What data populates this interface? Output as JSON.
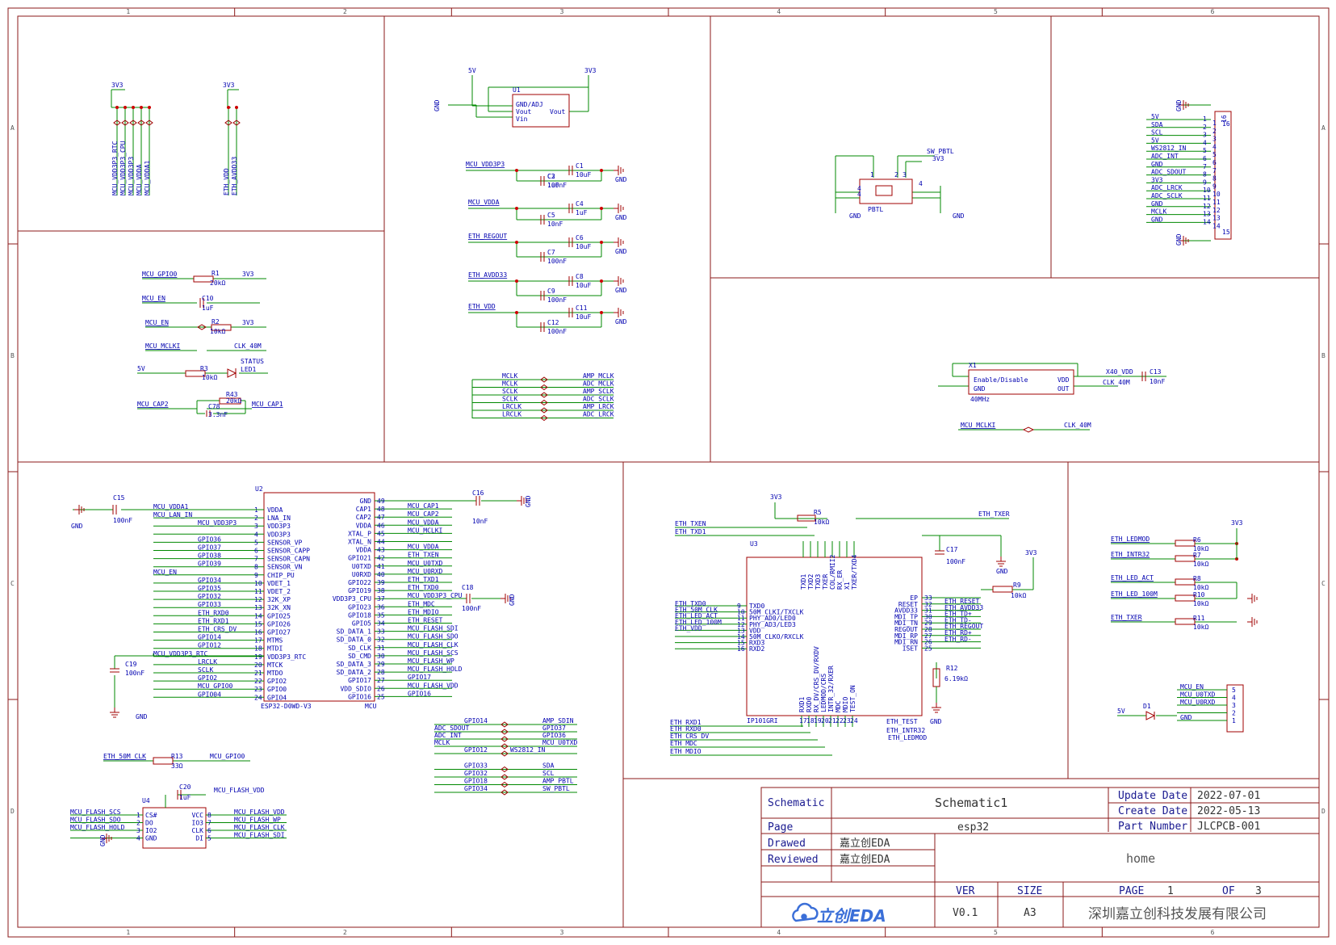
{
  "colors": {
    "frame": "#8b1a1a",
    "wire": "#008800",
    "net": "#0000b0",
    "part": "#a00000",
    "junction": "#cc0000",
    "grid": "#606060"
  },
  "grid": {
    "cols": [
      "1",
      "2",
      "3",
      "4",
      "5",
      "6"
    ],
    "rows": [
      "A",
      "B",
      "C",
      "D"
    ]
  },
  "power_caps": {
    "rail": "3V3",
    "nets_left": [
      "MCU_VDD3P3_RTC",
      "MCU_VDD3P3_CPU",
      "MCU_VDD3P3",
      "MCU_VDDA",
      "MCU_VDDA1"
    ],
    "nets_right": [
      "ETH_VDD",
      "ETH_AVDD33"
    ]
  },
  "ldo": {
    "ref": "U1",
    "in_rail": "5V",
    "out_rail": "3V3",
    "pins": [
      "GND/ADJ",
      "Vout",
      "Vin",
      "Vout"
    ],
    "gnd": "GND"
  },
  "decoupling": [
    {
      "net": "MCU_VDD3P3",
      "caps": [
        {
          "ref": "C1",
          "val": "10uF"
        },
        {
          "ref": "C2",
          "val": "100nF"
        },
        {
          "ref": "C3",
          "val": "1uF"
        }
      ],
      "gnd": "GND"
    },
    {
      "net": "MCU_VDDA",
      "caps": [
        {
          "ref": "C4",
          "val": "1uF"
        },
        {
          "ref": "C5",
          "val": "10nF"
        }
      ],
      "gnd": "GND"
    },
    {
      "net": "ETH_REGOUT",
      "caps": [
        {
          "ref": "C6",
          "val": "10uF"
        },
        {
          "ref": "C7",
          "val": "100nF"
        }
      ],
      "gnd": "GND"
    },
    {
      "net": "ETH_AVDD33",
      "caps": [
        {
          "ref": "C8",
          "val": "10uF"
        },
        {
          "ref": "C9",
          "val": "100nF"
        }
      ],
      "gnd": "GND"
    },
    {
      "net": "ETH_VDD",
      "caps": [
        {
          "ref": "C11",
          "val": "10uF"
        },
        {
          "ref": "C12",
          "val": "100nF"
        }
      ],
      "gnd": "GND"
    }
  ],
  "net_ties": [
    [
      "MCLK",
      "AMP_MCLK"
    ],
    [
      "MCLK",
      "ADC_MCLK"
    ],
    [
      "SCLK",
      "AMP_SCLK"
    ],
    [
      "SCLK",
      "ADC_SCLK"
    ],
    [
      "LRCLK",
      "AMP_LRCK"
    ],
    [
      "LRCLK",
      "ADC_LRCK"
    ]
  ],
  "pbtl": {
    "ref": "PBTL",
    "net": "SW_PBTL",
    "rail": "3V3",
    "gnd": "GND",
    "pins": [
      "1",
      "2",
      "3",
      "4",
      "4",
      "4"
    ]
  },
  "header16": {
    "ref": "16",
    "gnd": "GND",
    "nets": [
      "5V",
      "SDA",
      "SCL",
      "5V",
      "WS2812_IN",
      "ADC_INT",
      "GND",
      "ADC_SDOUT",
      "3V3",
      "ADC_LRCK",
      "ADC_SCLK",
      "GND",
      "MCLK",
      "GND"
    ],
    "pins": [
      "1",
      "2",
      "3",
      "4",
      "5",
      "6",
      "7",
      "8",
      "9",
      "10",
      "11",
      "12",
      "13",
      "14",
      "15",
      "16"
    ]
  },
  "oscillator": {
    "ref": "X1",
    "pins": [
      "Enable/Disable",
      "GND",
      "VDD",
      "OUT"
    ],
    "freq": "40MHz",
    "vdd_net": "X40_VDD",
    "out_net": "CLK_40M",
    "cap": {
      "ref": "C13",
      "val": "10nF"
    },
    "tie": [
      "MCU_MCLKI",
      "CLK_40M"
    ]
  },
  "misc_left": [
    {
      "net": "MCU_GPIO0",
      "ref": "R1",
      "val": "20kΩ",
      "to": "3V3"
    },
    {
      "net": "MCU_EN",
      "ref": "C10",
      "val": "1uF",
      "to": "GND"
    },
    {
      "net": "MCU_EN",
      "ref": "R2",
      "val": "10kΩ",
      "to": "3V3"
    },
    {
      "net": "MCU_MCLKI",
      "to": "CLK_40M"
    },
    {
      "net": "5V",
      "ref": "R3",
      "val": "10kΩ",
      "led": "LED1",
      "led_label": "STATUS",
      "to": "GND"
    },
    {
      "net": "MCU_CAP2",
      "ref": "R43",
      "val": "20kΩ",
      "cap_ref": "C78",
      "cap_val": "3.3nF",
      "to": "MCU_CAP1"
    }
  ],
  "mcu": {
    "ref": "U2",
    "name": "ESP32-D0WD-V3",
    "label": "MCU",
    "left_pins": [
      "VDDA",
      "LNA_IN",
      "VDD3P3",
      "VDD3P3",
      "SENSOR_VP",
      "SENSOR_CAPP",
      "SENSOR_CAPN",
      "SENSOR_VN",
      "CHIP_PU",
      "VDET_1",
      "VDET_2",
      "32K_XP",
      "32K_XN",
      "GPIO25",
      "GPIO26",
      "GPIO27",
      "MTMS",
      "MTDI",
      "VDD3P3_RTC",
      "MTCK",
      "MTDO",
      "GPIO2",
      "GPIO0",
      "GPIO4"
    ],
    "right_pins": [
      "GND",
      "CAP1",
      "CAP2",
      "VDDA",
      "XTAL_P",
      "XTAL_N",
      "VDDA",
      "GPIO21",
      "U0TXD",
      "U0RXD",
      "GPIO22",
      "GPIO19",
      "VDD3P3_CPU",
      "GPIO23",
      "GPIO18",
      "GPIO5",
      "SD_DATA_1",
      "SD_DATA_0",
      "SD_CLK",
      "SD_CMD",
      "SD_DATA_3",
      "SD_DATA_2",
      "GPIO17",
      "VDD_SDIO",
      "GPIO16"
    ],
    "left_nets": [
      "MCU_VDDA1",
      "MCU_LAN_IN",
      "MCU_VDD3P3",
      "",
      "GPIO36",
      "GPIO37",
      "GPIO38",
      "GPIO39",
      "MCU_EN",
      "GPIO34",
      "GPIO35",
      "GPIO32",
      "GPIO33",
      "ETH_RXD0",
      "ETH_RXD1",
      "ETH_CRS_DV",
      "GPIO14",
      "GPIO12",
      "MCU_VDD3P3_RTC",
      "LRCLK",
      "SCLK",
      "GPIO2",
      "MCU_GPIO0",
      "GPIO04"
    ],
    "right_nets": [
      "",
      "MCU_CAP1",
      "MCU_CAP2",
      "MCU_VDDA",
      "MCU_MCLKI",
      "",
      "MCU_VDDA",
      "ETH_TXEN",
      "MCU_U0TXD",
      "MCU_U0RXD",
      "ETH_TXD1",
      "ETH_TXD0",
      "MCU_VDD3P3_CPU",
      "ETH_MDC",
      "ETH_MDIO",
      "ETH_RESET",
      "MCU_FLASH_SDI",
      "MCU_FLASH_SDO",
      "MCU_FLASH_CLK",
      "MCU_FLASH_SCS",
      "MCU_FLASH_WP",
      "MCU_FLASH_HOLD",
      "GPIO17",
      "MCU_FLASH_VDD",
      "GPIO16"
    ],
    "caps": [
      {
        "ref": "C15",
        "val": "100nF"
      },
      {
        "ref": "C16",
        "val": "10nF"
      },
      {
        "ref": "C18",
        "val": "100nF"
      },
      {
        "ref": "C19",
        "val": "100nF"
      }
    ],
    "gnd": "GND"
  },
  "gpio_ties": [
    [
      "GPIO14",
      "AMP_SDIN"
    ],
    [
      "ADC_SDOUT",
      "GPIO37"
    ],
    [
      "ADC_INT",
      "GPIO36"
    ],
    [
      "MCLK",
      "MCU_U0TXD"
    ],
    [
      "GPIO12",
      "WS2812_IN"
    ],
    [
      "GPIO33",
      "SDA"
    ],
    [
      "GPIO32",
      "SCL"
    ],
    [
      "GPIO18",
      "AMP_PBTL"
    ],
    [
      "GPIO34",
      "SW_PBTL"
    ]
  ],
  "r13": {
    "net": "ETH_50M_CLK",
    "ref": "R13",
    "val": "33Ω",
    "to": "MCU_GPIO0"
  },
  "flash": {
    "ref": "U4",
    "cap": {
      "ref": "C20",
      "val": "1uF",
      "net": "MCU_FLASH_VDD"
    },
    "left_pins": [
      "CS#",
      "DO",
      "IO2",
      "GND"
    ],
    "left_nums": [
      "1",
      "2",
      "3",
      "4"
    ],
    "right_pins": [
      "VCC",
      "IO3",
      "CLK",
      "DI"
    ],
    "right_nums": [
      "8",
      "7",
      "6",
      "5"
    ],
    "left_nets": [
      "MCU_FLASH_SCS",
      "MCU_FLASH_SDO",
      "MCU_FLASH_HOLD"
    ],
    "right_nets": [
      "MCU_FLASH_VDD",
      "MCU_FLASH_WP",
      "MCU_FLASH_CLK",
      "MCU_FLASH_SDI"
    ],
    "gnd": "GND"
  },
  "phy": {
    "ref": "U3",
    "name": "IP101GRI",
    "rail": "3V3",
    "top_pins": [
      "TXD1",
      "TXD2",
      "TXD3",
      "TXER",
      "COL/RMII2",
      "RX_ER",
      "X1",
      "TXER/TXD4"
    ],
    "left_pins": [
      "TXD0",
      "50M_CLKI/TXCLK",
      "PHY_AD0/LED0",
      "PHY_AD3/LED3",
      "VDD",
      "50M_CLKO/RXCLK",
      "RXD3",
      "RXD2"
    ],
    "left_nums": [
      "9",
      "10",
      "11",
      "12",
      "13",
      "14",
      "15",
      "16"
    ],
    "right_pins": [
      "EP",
      "RESET",
      "AVDD33",
      "MDI_TP",
      "MDI_TN",
      "REGOUT",
      "MDI_RP",
      "MDI_RN",
      "ISET"
    ],
    "right_nums": [
      "33",
      "32",
      "31",
      "30",
      "29",
      "28",
      "27",
      "26",
      "25"
    ],
    "bottom_pins": [
      "RXD1",
      "RXD0",
      "RX_DV/CRS_DV/RXDV",
      "LEDMOD/CRS",
      "INTR_32/RXER",
      "MDC",
      "MDIO",
      "TEST_ON"
    ],
    "bottom_nums": [
      "17",
      "18",
      "19",
      "20",
      "21",
      "22",
      "23",
      "24"
    ],
    "left_nets": [
      "ETH_TXD0",
      "ETH_50M_CLK",
      "ETH_LED_ACT",
      "ETH_LED_100M",
      "ETH_VDD"
    ],
    "right_nets": [
      "ETH_RESET",
      "ETH_AVDD33",
      "ETH_TD+",
      "ETH_TD-",
      "ETH_REGOUT",
      "ETH_RD+",
      "ETH_RD-"
    ],
    "top_nets": [
      "ETH_TXEN",
      "ETH_TXD1",
      "ETH_TXER"
    ],
    "bottom_nets": [
      "ETH_RXD1",
      "ETH_RXD0",
      "ETH_CRS_DV",
      "ETH_MDC",
      "ETH_MDIO",
      "ETH_TEST",
      "ETH_INTR32",
      "ETH_LEDMOD"
    ],
    "parts": [
      {
        "ref": "R5",
        "val": "10kΩ"
      },
      {
        "ref": "R9",
        "val": "10kΩ"
      },
      {
        "ref": "R12",
        "val": "6.19kΩ"
      },
      {
        "ref": "C17",
        "val": "100nF"
      }
    ],
    "gnd": "GND"
  },
  "eth_straps": [
    {
      "net": "ETH_LEDMOD",
      "ref": "R6",
      "val": "10kΩ"
    },
    {
      "net": "ETH_INTR32",
      "ref": "R7",
      "val": "10kΩ"
    },
    {
      "net": "ETH_LED_ACT",
      "ref": "R8",
      "val": "10kΩ"
    },
    {
      "net": "ETH_LED_100M",
      "ref": "R10",
      "val": "10kΩ"
    },
    {
      "net": "ETH_TXER",
      "ref": "R11",
      "val": "10kΩ"
    }
  ],
  "eth_straps_rail": "3V3",
  "uart_header": {
    "nets": [
      "MCU_EN",
      "MCU_U0TXD",
      "MCU_U0RXD",
      "5V",
      "GND"
    ],
    "pins": [
      "5",
      "4",
      "3",
      "2",
      "1"
    ],
    "diode": "D1"
  },
  "title_block": {
    "schematic_label": "Schematic",
    "schematic_value": "Schematic1",
    "page_label": "Page",
    "page_value": "esp32",
    "drawed_label": "Drawed",
    "drawed_value": "嘉立创EDA",
    "reviewed_label": "Reviewed",
    "reviewed_value": "嘉立创EDA",
    "update_label": "Update Date",
    "update_value": "2022-07-01",
    "create_label": "Create Date",
    "create_value": "2022-05-13",
    "part_label": "Part Number",
    "part_value": "JLCPCB-001",
    "home": "home",
    "ver_label": "VER",
    "ver_value": "V0.1",
    "size_label": "SIZE",
    "size_value": "A3",
    "pageno_label": "PAGE",
    "pageno_value": "1",
    "of_label": "OF",
    "of_value": "3",
    "company": "深圳嘉立创科技发展有限公司",
    "logo": "立创EDA"
  }
}
